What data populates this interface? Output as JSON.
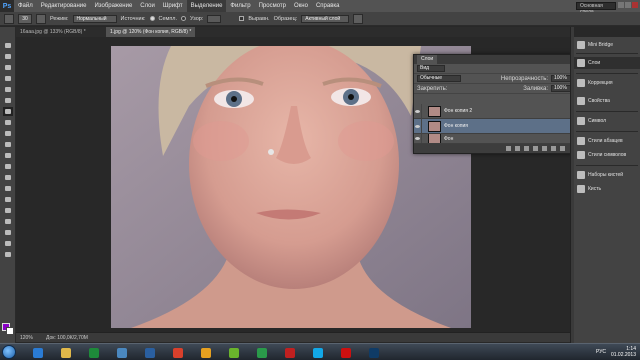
{
  "app": {
    "logo": "Ps"
  },
  "menu": [
    "Файл",
    "Редактирование",
    "Изображение",
    "Слои",
    "Шрифт",
    "Выделение",
    "Фильтр",
    "Просмотр",
    "Окно",
    "Справка"
  ],
  "workspace": {
    "label": "Основная среда"
  },
  "options": {
    "brush_size": "30",
    "mode_label": "Режим:",
    "mode_value": "Нормальный",
    "source_label": "Источник:",
    "source_sampled": "Семпл.",
    "source_pattern": "Узор:",
    "aligned_label": "Выравн.",
    "sample_label": "Образец:",
    "sample_value": "Активный слой"
  },
  "tabs": [
    {
      "label": "16aaa.jpg @ 133% (RGB/8) *",
      "active": false
    },
    {
      "label": "1.jpg @ 120% (Фон копия, RGB/8) *",
      "active": true
    }
  ],
  "status": {
    "zoom": "120%",
    "doc": "Док: 100,0К/2,70М"
  },
  "layers_panel": {
    "tab": "Слои",
    "filter": "Вид",
    "blend": "Обычные",
    "opacity_label": "Непрозрачность:",
    "opacity_value": "100%",
    "lock_label": "Закрепить:",
    "fill_label": "Заливка:",
    "fill_value": "100%",
    "layers": [
      {
        "name": "Фон копия 2",
        "active": false
      },
      {
        "name": "Фон копия",
        "active": true
      },
      {
        "name": "Фон",
        "active": false
      }
    ]
  },
  "right_panels": [
    {
      "label": "Mini Bridge",
      "icon": "mini-bridge-icon",
      "selected": false
    },
    {
      "label": "Слои",
      "icon": "layers-icon",
      "selected": true
    },
    {
      "label": "Коррекция",
      "icon": "adjustments-icon",
      "selected": false
    },
    {
      "label": "Свойства",
      "icon": "properties-icon",
      "selected": false
    },
    {
      "label": "Символ",
      "icon": "character-icon",
      "selected": false
    },
    {
      "label": "Стили абзацев",
      "icon": "paragraph-styles-icon",
      "selected": false
    },
    {
      "label": "Стили символов",
      "icon": "character-styles-icon",
      "selected": false
    },
    {
      "label": "Наборы кистей",
      "icon": "brush-presets-icon",
      "selected": false
    },
    {
      "label": "Кисть",
      "icon": "brush-icon",
      "selected": false
    }
  ],
  "colors": {
    "foreground": "#8a00c8",
    "background": "#ffffff"
  },
  "taskbar": {
    "lang": "РУС",
    "time": "1:14",
    "date": "01.02.2013",
    "apps": [
      {
        "name": "ie-icon",
        "color": "#2a7bd4"
      },
      {
        "name": "explorer-icon",
        "color": "#e0b84a"
      },
      {
        "name": "excel-icon",
        "color": "#1e8a3a"
      },
      {
        "name": "monitor-icon",
        "color": "#4a88c0"
      },
      {
        "name": "mediaplayer-icon",
        "color": "#2a5fa0"
      },
      {
        "name": "chrome-icon",
        "color": "#d9402c"
      },
      {
        "name": "winamp-icon",
        "color": "#e6a020"
      },
      {
        "name": "utorrent-icon",
        "color": "#6ab42c"
      },
      {
        "name": "mail-icon",
        "color": "#2a9a4a"
      },
      {
        "name": "z-app-icon",
        "color": "#c02020"
      },
      {
        "name": "skype-icon",
        "color": "#12a8e8"
      },
      {
        "name": "opera-icon",
        "color": "#cc1010"
      },
      {
        "name": "photoshop-icon",
        "color": "#0f3b66"
      }
    ]
  }
}
